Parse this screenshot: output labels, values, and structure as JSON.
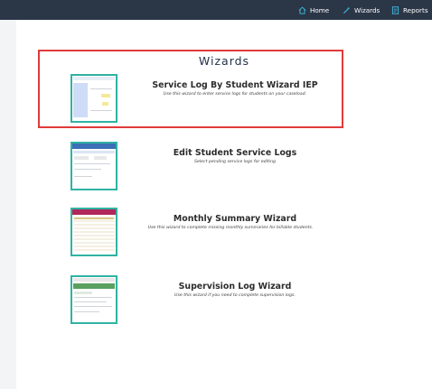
{
  "nav": {
    "items": [
      {
        "label": "Home",
        "icon": "home-icon"
      },
      {
        "label": "Wizards",
        "icon": "wand-icon"
      },
      {
        "label": "Reports",
        "icon": "report-icon"
      }
    ]
  },
  "page": {
    "title": "Wizards"
  },
  "wizards": [
    {
      "title": "Service Log By Student Wizard IEP",
      "subtitle": "Use this wizard to enter service logs for students on your caseload."
    },
    {
      "title": "Edit Student Service Logs",
      "subtitle": "Select pending service logs for editing"
    },
    {
      "title": "Monthly Summary Wizard",
      "subtitle": "Use this wizard to complete missing monthly summaries for billable students."
    },
    {
      "title": "Supervision Log Wizard",
      "subtitle": "Use this wizard if you need to complete supervision logs."
    }
  ],
  "colors": {
    "topbar": "#2b3647",
    "icon": "#3fc0e6",
    "highlight": "#e03a3a",
    "thumb_border": "#2fb3a3"
  }
}
